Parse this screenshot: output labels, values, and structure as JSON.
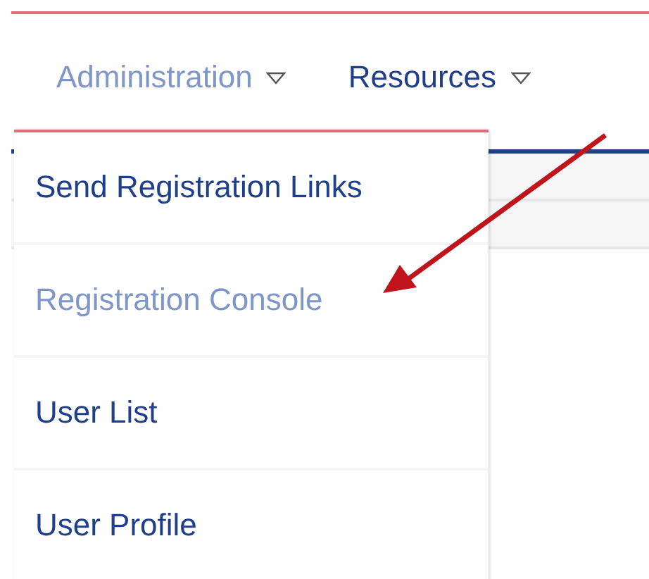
{
  "nav": {
    "items": [
      {
        "label": "Administration",
        "selected": true
      },
      {
        "label": "Resources",
        "selected": false
      }
    ]
  },
  "menu": {
    "items": [
      {
        "label": "Send Registration Links",
        "selected": false
      },
      {
        "label": "Registration Console",
        "selected": true
      },
      {
        "label": "User List",
        "selected": false
      },
      {
        "label": "User Profile",
        "selected": false
      }
    ]
  }
}
